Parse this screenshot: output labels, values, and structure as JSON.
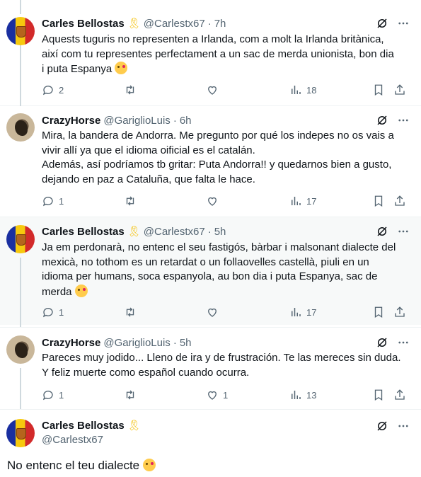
{
  "tweets": [
    {
      "name": "Carles Bellostas",
      "handle": "@Carlestx67",
      "time": "7h",
      "text": "Aquests tuguris no representen a Irlanda, com a molt la Irlanda britànica,\naixí com tu representes perfectament a un sac de merda unionista, bon dia\ni puta Espanya",
      "replies": "2",
      "retweets": "",
      "likes": "",
      "views": "18"
    },
    {
      "name": "CrazyHorse",
      "handle": "@GariglioLuis",
      "time": "6h",
      "text": "Mira, la bandera de Andorra. Me pregunto por qué los indepes no os vais a\nvivir allí ya que el idioma oificial es el catalán.\nAdemás, así podríamos tb gritar: Puta Andorra!! y quedarnos bien a gusto,\ndejando en paz a Cataluña, que falta le hace.",
      "replies": "1",
      "retweets": "",
      "likes": "",
      "views": "17"
    },
    {
      "name": "Carles Bellostas",
      "handle": "@Carlestx67",
      "time": "5h",
      "text": "Ja em perdonarà, no entenc el seu fastigós, bàrbar i malsonant dialecte del\nmexicà, no tothom es un retardat o un follaovelles castellà, piuli en un\nidioma per humans, soca espanyola, au bon dia i puta Espanya, sac de\nmerda",
      "replies": "1",
      "retweets": "",
      "likes": "",
      "views": "17"
    },
    {
      "name": "CrazyHorse",
      "handle": "@GariglioLuis",
      "time": "5h",
      "text": "Pareces muy jodido... Lleno de ira y de frustración. Te las mereces sin duda.\nY feliz muerte como español cuando ocurra.",
      "replies": "1",
      "retweets": "",
      "likes": "1",
      "views": "13"
    }
  ],
  "last_tweet": {
    "name": "Carles Bellostas",
    "handle": "@Carlestx67",
    "text": "No entenc el teu dialecte"
  },
  "dot": "·",
  "icons": [
    "reply-icon",
    "retweet-icon",
    "like-icon",
    "views-icon",
    "bookmark-icon",
    "share-icon",
    "grok-icon",
    "more-icon",
    "ribbon-icon",
    "kiss-emoji"
  ],
  "colors": {
    "muted": "#536471",
    "text": "#0f1419",
    "highlight": "#f7f9f9",
    "ribbon": "#f4c20d"
  }
}
